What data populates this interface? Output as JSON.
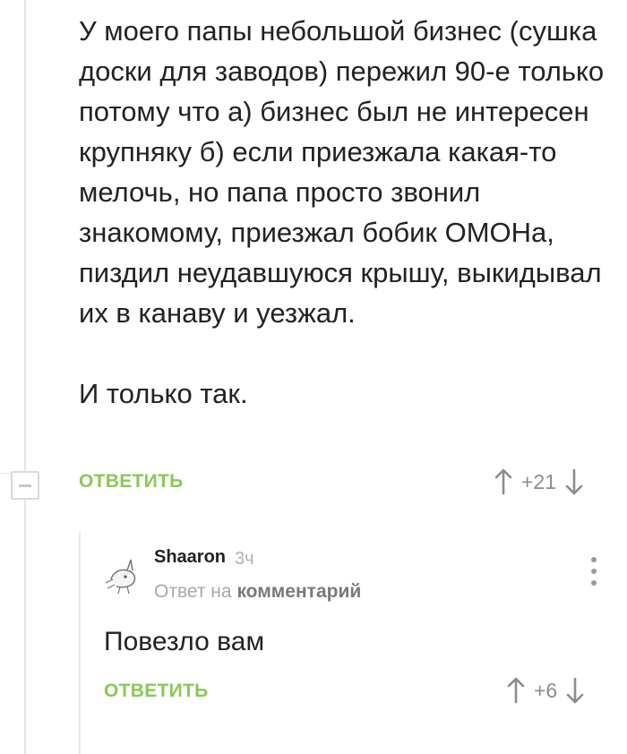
{
  "comment": {
    "paragraph1": "У моего папы небольшой бизнес (сушка доски для заводов) пережил 90-е только потому что а) бизнес был не интересен крупняку б) если приезжала какая-то мелочь, но папа просто звонил знакомому, приезжал бобик ОМОНа, пиздил неудавшуюся крышу, выкидывал их в канаву и уезжал.",
    "paragraph2": "И только так.",
    "reply_label": "ОТВЕТИТЬ",
    "score": "+21",
    "collapse_icon": "minus-icon"
  },
  "reply": {
    "author": "Shaaron",
    "time": "3ч",
    "reply_to_prefix": "Ответ на",
    "reply_to_target": "комментарий",
    "text": "Повезло вам",
    "reply_label": "ОТВЕТИТЬ",
    "score": "+6",
    "menu_icon": "more-vertical-icon",
    "avatar_icon": "cartoon-avatar-icon"
  },
  "colors": {
    "accent_green": "#8ac858",
    "text": "#222222",
    "muted": "#8c8c8c",
    "thread_line": "#e6e6e6"
  }
}
